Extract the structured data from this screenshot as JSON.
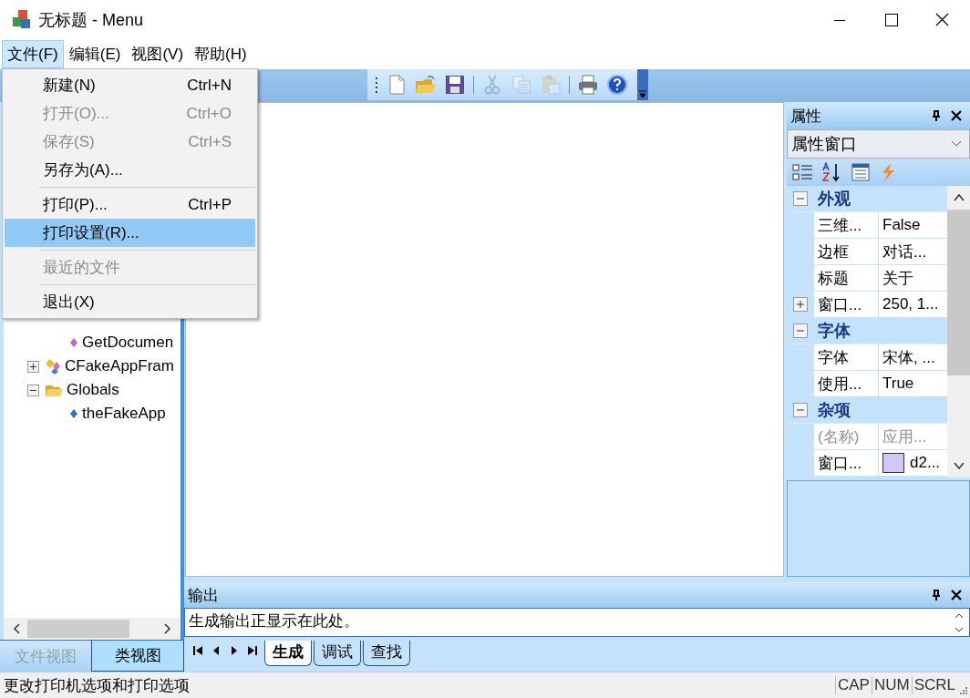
{
  "window": {
    "title": "无标题 - Menu"
  },
  "menubar": {
    "items": [
      {
        "label": "文件(F)",
        "selected": true
      },
      {
        "label": "编辑(E)",
        "selected": false
      },
      {
        "label": "视图(V)",
        "selected": false
      },
      {
        "label": "帮助(H)",
        "selected": false
      }
    ]
  },
  "file_menu": {
    "items": [
      {
        "kind": "item",
        "label": "新建(N)",
        "shortcut": "Ctrl+N",
        "disabled": false,
        "selected": false
      },
      {
        "kind": "item",
        "label": "打开(O)...",
        "shortcut": "Ctrl+O",
        "disabled": true,
        "selected": false
      },
      {
        "kind": "item",
        "label": "保存(S)",
        "shortcut": "Ctrl+S",
        "disabled": true,
        "selected": false
      },
      {
        "kind": "item",
        "label": "另存为(A)...",
        "disabled": false,
        "selected": false
      },
      {
        "kind": "separator"
      },
      {
        "kind": "item",
        "label": "打印(P)...",
        "shortcut": "Ctrl+P",
        "disabled": false,
        "selected": false
      },
      {
        "kind": "item",
        "label": "打印设置(R)...",
        "disabled": false,
        "selected": true
      },
      {
        "kind": "separator"
      },
      {
        "kind": "item",
        "label": "最近的文件",
        "disabled": true,
        "selected": false
      },
      {
        "kind": "separator"
      },
      {
        "kind": "item",
        "label": "退出(X)",
        "disabled": false,
        "selected": false
      }
    ]
  },
  "toolbar": {
    "buttons": [
      {
        "disabled": false
      },
      {
        "disabled": false
      },
      {
        "disabled": false
      },
      {
        "disabled": true
      },
      {
        "disabled": true
      },
      {
        "disabled": true
      },
      {
        "disabled": false
      },
      {
        "disabled": false
      }
    ]
  },
  "class_view": {
    "tree": [
      {
        "children": [
          {
            "label": "GetDocumen",
            "kind": "method"
          }
        ]
      },
      {
        "label": "CFakeAppFram",
        "kind": "class",
        "expanded": false
      },
      {
        "label": "Globals",
        "kind": "folder",
        "expanded": true,
        "children": [
          {
            "label": "theFakeApp",
            "kind": "variable"
          }
        ]
      }
    ],
    "tabs": [
      {
        "label": "文件视图",
        "selected": false
      },
      {
        "label": "类视图",
        "selected": true
      }
    ]
  },
  "properties": {
    "title": "属性",
    "selector": "属性窗口",
    "groups": [
      {
        "label": "外观",
        "expanded": true,
        "rows": [
          {
            "name": "三维...",
            "value": "False",
            "disabled": false
          },
          {
            "name": "边框",
            "value": "对话...",
            "disabled": false
          },
          {
            "name": "标题",
            "value": "关于",
            "disabled": false
          },
          {
            "name": "窗口...",
            "value": "250, 1...",
            "disabled": false,
            "expanded": false
          }
        ]
      },
      {
        "label": "字体",
        "expanded": true,
        "rows": [
          {
            "name": "字体",
            "value": "宋体, ...",
            "disabled": false
          },
          {
            "name": "使用...",
            "value": "True",
            "disabled": false
          }
        ]
      },
      {
        "label": "杂项",
        "expanded": true,
        "rows": [
          {
            "name": "(名称)",
            "value": "应用...",
            "disabled": true
          },
          {
            "name": "窗口...",
            "value": "d2...",
            "disabled": false,
            "color": "#d2c8f8"
          }
        ]
      }
    ]
  },
  "output": {
    "title": "输出",
    "lines": [
      "生成输出正显示在此处。"
    ],
    "tabs": [
      {
        "label": "生成",
        "selected": true
      },
      {
        "label": "调试",
        "selected": false
      },
      {
        "label": "查找",
        "selected": false
      }
    ]
  },
  "status_bar": {
    "text": "更改打印机选项和打印选项",
    "indicators": [
      "CAP",
      "NUM",
      "SCRL"
    ]
  }
}
